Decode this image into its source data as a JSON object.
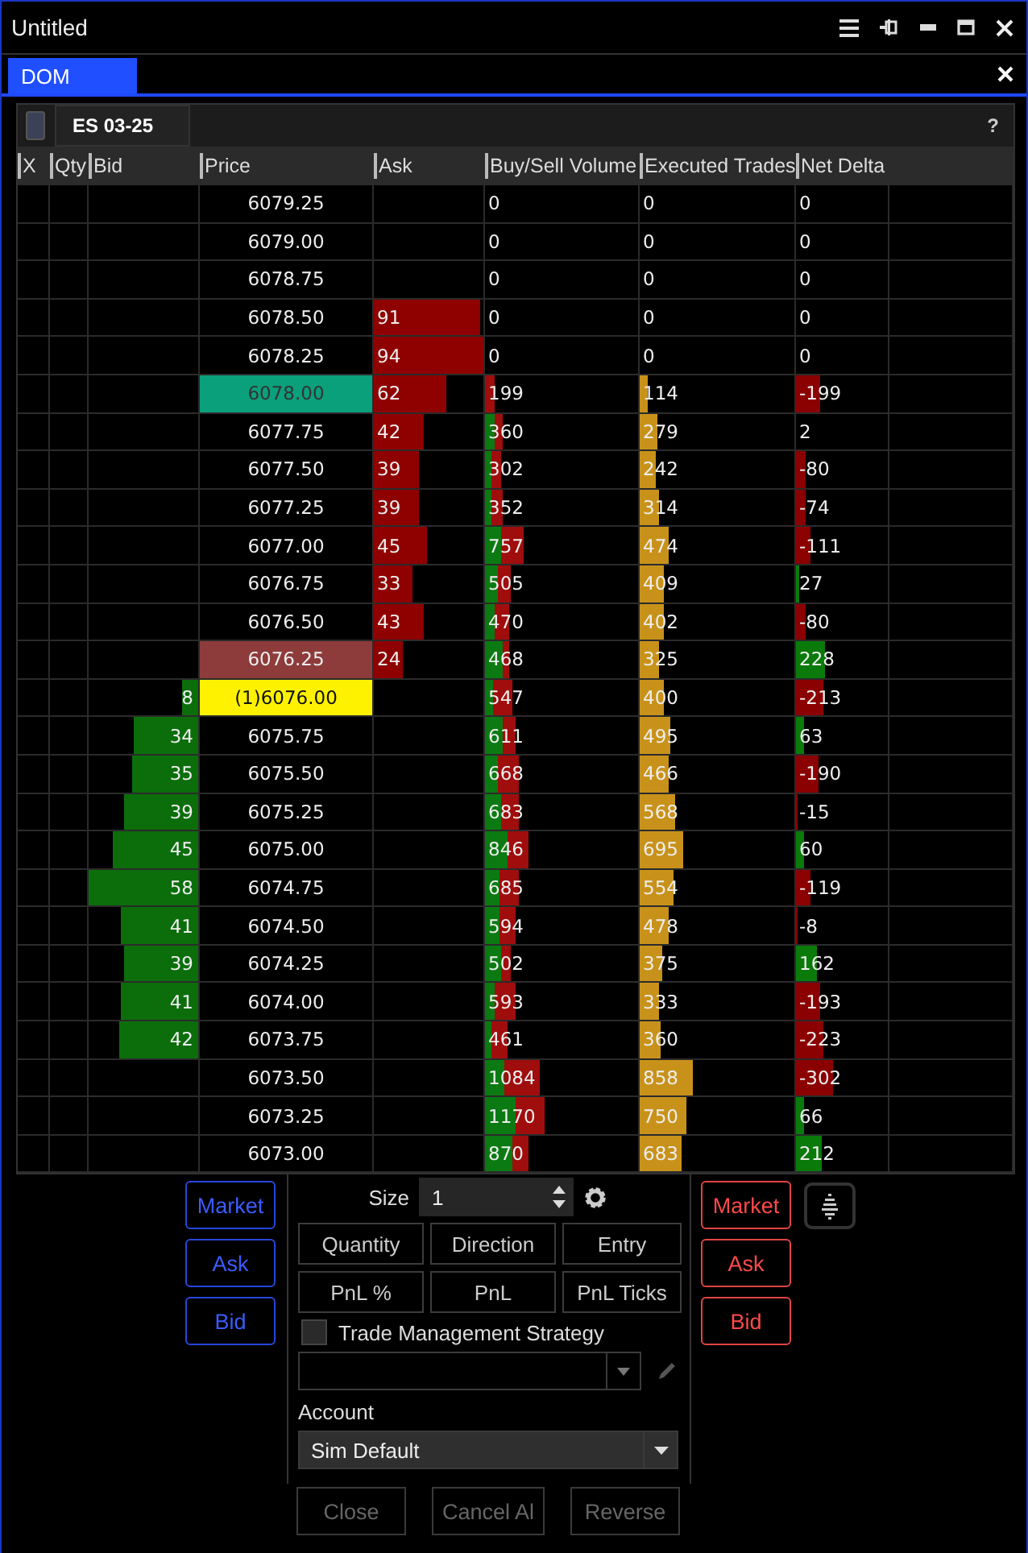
{
  "window": {
    "title": "Untitled"
  },
  "tabs": [
    {
      "label": "DOM",
      "selected": true
    }
  ],
  "instrument": {
    "symbol": "ES 03-25",
    "help": "?"
  },
  "columns": [
    "X",
    "Qty",
    "Bid",
    "Price",
    "Ask",
    "Buy/Sell Volume",
    "Executed Trades",
    "Net Delta"
  ],
  "rows": [
    {
      "price": "6079.25",
      "kind": "plain",
      "volume": {
        "text": "0"
      },
      "trades": {
        "text": "0"
      },
      "delta": {
        "text": "0"
      }
    },
    {
      "price": "6079.00",
      "kind": "plain",
      "volume": {
        "text": "0"
      },
      "trades": {
        "text": "0"
      },
      "delta": {
        "text": "0"
      }
    },
    {
      "price": "6078.75",
      "kind": "plain",
      "volume": {
        "text": "0"
      },
      "trades": {
        "text": "0"
      },
      "delta": {
        "text": "0"
      }
    },
    {
      "price": "6078.50",
      "kind": "plain",
      "ask": {
        "text": "91",
        "level": 0.97
      },
      "volume": {
        "text": "0"
      },
      "trades": {
        "text": "0"
      },
      "delta": {
        "text": "0"
      }
    },
    {
      "price": "6078.25",
      "kind": "plain",
      "ask": {
        "text": "94",
        "level": 1.0
      },
      "volume": {
        "text": "0"
      },
      "trades": {
        "text": "0"
      },
      "delta": {
        "text": "0"
      }
    },
    {
      "price": "6078.00",
      "kind": "last",
      "ask": {
        "text": "62",
        "level": 0.66
      },
      "volume": {
        "text": "199",
        "level": 0.066
      },
      "trades": {
        "text": "114",
        "level": 0.05
      },
      "delta": {
        "text": "-199",
        "level": 0.27,
        "color": "#8b0000"
      }
    },
    {
      "price": "6077.75",
      "kind": "plain",
      "ask": {
        "text": "42",
        "level": 0.45
      },
      "volume": {
        "text": "360",
        "level": 0.119,
        "buy": {
          "level": 0.06
        }
      },
      "trades": {
        "text": "279",
        "level": 0.11
      },
      "delta": {
        "text": "2"
      }
    },
    {
      "price": "6077.50",
      "kind": "plain",
      "ask": {
        "text": "39",
        "level": 0.41
      },
      "volume": {
        "text": "302",
        "level": 0.1,
        "buy": {
          "level": 0.037
        }
      },
      "trades": {
        "text": "242",
        "level": 0.1
      },
      "delta": {
        "text": "-80",
        "level": 0.11,
        "color": "#8b0000"
      }
    },
    {
      "price": "6077.25",
      "kind": "plain",
      "ask": {
        "text": "39",
        "level": 0.41
      },
      "volume": {
        "text": "352",
        "level": 0.116,
        "buy": {
          "level": 0.046
        }
      },
      "trades": {
        "text": "314",
        "level": 0.13
      },
      "delta": {
        "text": "-74",
        "level": 0.1,
        "color": "#8b0000"
      }
    },
    {
      "price": "6077.00",
      "kind": "plain",
      "ask": {
        "text": "45",
        "level": 0.48
      },
      "volume": {
        "text": "757",
        "level": 0.25,
        "buy": {
          "level": 0.107
        }
      },
      "trades": {
        "text": "474",
        "level": 0.19
      },
      "delta": {
        "text": "-111",
        "level": 0.15,
        "color": "#8b0000"
      }
    },
    {
      "price": "6076.75",
      "kind": "plain",
      "ask": {
        "text": "33",
        "level": 0.35
      },
      "volume": {
        "text": "505",
        "level": 0.167,
        "buy": {
          "level": 0.088
        }
      },
      "trades": {
        "text": "409",
        "level": 0.16
      },
      "delta": {
        "text": "27",
        "level": 0.04,
        "color": "#0a7a0a"
      }
    },
    {
      "price": "6076.50",
      "kind": "plain",
      "ask": {
        "text": "43",
        "level": 0.46
      },
      "volume": {
        "text": "470",
        "level": 0.155,
        "buy": {
          "level": 0.064
        }
      },
      "trades": {
        "text": "402",
        "level": 0.16
      },
      "delta": {
        "text": "-80",
        "level": 0.11,
        "color": "#8b0000"
      }
    },
    {
      "price": "6076.25",
      "kind": "ask",
      "ask": {
        "text": "24",
        "level": 0.26
      },
      "volume": {
        "text": "468",
        "level": 0.155,
        "buy": {
          "level": 0.115
        }
      },
      "trades": {
        "text": "325",
        "level": 0.13
      },
      "delta": {
        "text": "228",
        "level": 0.31,
        "color": "#0a7a0a"
      }
    },
    {
      "price": "(1)6076.00",
      "kind": "entry",
      "bid": {
        "text": "8",
        "level": 0.14
      },
      "volume": {
        "text": "547",
        "level": 0.18,
        "buy": {
          "level": 0.055
        }
      },
      "trades": {
        "text": "400",
        "level": 0.16
      },
      "delta": {
        "text": "-213",
        "level": 0.29,
        "color": "#8b0000"
      }
    },
    {
      "price": "6075.75",
      "kind": "plain",
      "bid": {
        "text": "34",
        "level": 0.59
      },
      "volume": {
        "text": "611",
        "level": 0.201,
        "buy": {
          "level": 0.111
        }
      },
      "trades": {
        "text": "495",
        "level": 0.2
      },
      "delta": {
        "text": "63",
        "level": 0.08,
        "color": "#0a7a0a"
      }
    },
    {
      "price": "6075.50",
      "kind": "plain",
      "bid": {
        "text": "35",
        "level": 0.6
      },
      "volume": {
        "text": "668",
        "level": 0.221,
        "buy": {
          "level": 0.079
        }
      },
      "trades": {
        "text": "466",
        "level": 0.19
      },
      "delta": {
        "text": "-190",
        "level": 0.25,
        "color": "#8b0000"
      }
    },
    {
      "price": "6075.25",
      "kind": "plain",
      "bid": {
        "text": "39",
        "level": 0.67
      },
      "volume": {
        "text": "683",
        "level": 0.225,
        "buy": {
          "level": 0.11
        }
      },
      "trades": {
        "text": "568",
        "level": 0.23
      },
      "delta": {
        "text": "-15",
        "level": 0.02,
        "color": "#8b0000"
      }
    },
    {
      "price": "6075.00",
      "kind": "plain",
      "bid": {
        "text": "45",
        "level": 0.78
      },
      "volume": {
        "text": "846",
        "level": 0.28,
        "buy": {
          "level": 0.15
        }
      },
      "trades": {
        "text": "695",
        "level": 0.28
      },
      "delta": {
        "text": "60",
        "level": 0.08,
        "color": "#0a7a0a"
      }
    },
    {
      "price": "6074.75",
      "kind": "plain",
      "bid": {
        "text": "58",
        "level": 1.0
      },
      "volume": {
        "text": "685",
        "level": 0.226,
        "buy": {
          "level": 0.093
        }
      },
      "trades": {
        "text": "554",
        "level": 0.22
      },
      "delta": {
        "text": "-119",
        "level": 0.16,
        "color": "#8b0000"
      }
    },
    {
      "price": "6074.50",
      "kind": "plain",
      "bid": {
        "text": "41",
        "level": 0.71
      },
      "volume": {
        "text": "594",
        "level": 0.196,
        "buy": {
          "level": 0.097
        }
      },
      "trades": {
        "text": "478",
        "level": 0.19
      },
      "delta": {
        "text": "-8",
        "level": 0.01,
        "color": "#8b0000"
      }
    },
    {
      "price": "6074.25",
      "kind": "plain",
      "bid": {
        "text": "39",
        "level": 0.67
      },
      "volume": {
        "text": "502",
        "level": 0.166,
        "buy": {
          "level": 0.11
        }
      },
      "trades": {
        "text": "375",
        "level": 0.15
      },
      "delta": {
        "text": "162",
        "level": 0.22,
        "color": "#0a7a0a"
      }
    },
    {
      "price": "6074.00",
      "kind": "plain",
      "bid": {
        "text": "41",
        "level": 0.71
      },
      "volume": {
        "text": "593",
        "level": 0.196,
        "buy": {
          "level": 0.066
        }
      },
      "trades": {
        "text": "333",
        "level": 0.13
      },
      "delta": {
        "text": "-193",
        "level": 0.26,
        "color": "#8b0000"
      }
    },
    {
      "price": "6073.75",
      "kind": "plain",
      "bid": {
        "text": "42",
        "level": 0.72
      },
      "volume": {
        "text": "461",
        "level": 0.152,
        "buy": {
          "level": 0.039
        }
      },
      "trades": {
        "text": "360",
        "level": 0.14
      },
      "delta": {
        "text": "-223",
        "level": 0.3,
        "color": "#8b0000"
      }
    },
    {
      "price": "6073.50",
      "kind": "plain",
      "volume": {
        "text": "1084",
        "level": 0.358,
        "buy": {
          "level": 0.129
        }
      },
      "trades": {
        "text": "858",
        "level": 0.34
      },
      "delta": {
        "text": "-302",
        "level": 0.4,
        "color": "#8b0000"
      }
    },
    {
      "price": "6073.25",
      "kind": "plain",
      "volume": {
        "text": "1170",
        "level": 0.386,
        "buy": {
          "level": 0.204
        }
      },
      "trades": {
        "text": "750",
        "level": 0.3
      },
      "delta": {
        "text": "66",
        "level": 0.09,
        "color": "#0a7a0a"
      }
    },
    {
      "price": "6073.00",
      "kind": "plain",
      "volume": {
        "text": "870",
        "level": 0.288,
        "buy": {
          "level": 0.179
        }
      },
      "trades": {
        "text": "683",
        "level": 0.27
      },
      "delta": {
        "text": "212",
        "level": 0.28,
        "color": "#0a7a0a"
      }
    }
  ],
  "buy_buttons": [
    "Market",
    "Ask",
    "Bid"
  ],
  "sell_buttons": [
    "Market",
    "Ask",
    "Bid"
  ],
  "order": {
    "size_label": "Size",
    "size": "1",
    "fields": [
      "Quantity",
      "Direction",
      "Entry",
      "PnL %",
      "PnL",
      "PnL Ticks"
    ],
    "strategy": {
      "label": "Trade Management Strategy",
      "checked": false
    },
    "account_label": "Account",
    "account": "Sim Default"
  },
  "actions": [
    {
      "label": "Close",
      "disabled": true
    },
    {
      "label": "Cancel Al",
      "disabled": true
    },
    {
      "label": "Reverse",
      "disabled": true
    }
  ]
}
